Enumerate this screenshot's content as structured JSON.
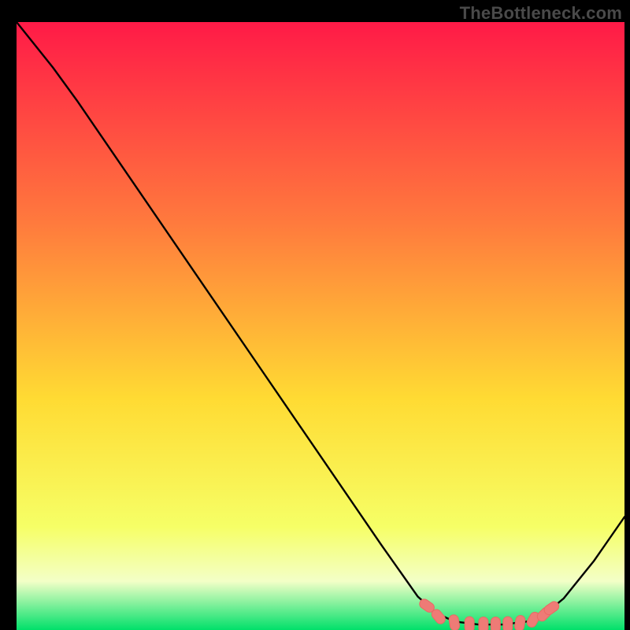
{
  "attribution": "TheBottleneck.com",
  "colors": {
    "gradient_top": "#ff1a47",
    "gradient_mid_upper": "#ff7a3d",
    "gradient_mid": "#ffdb33",
    "gradient_lower": "#f6ff66",
    "gradient_pale": "#f3ffc7",
    "gradient_bottom": "#00e06a",
    "curve": "#000000",
    "marker_fill": "#ee7b76",
    "marker_stroke": "#e86a63"
  },
  "chart_data": {
    "type": "line",
    "title": "",
    "xlabel": "",
    "ylabel": "",
    "xlim": [
      0,
      100
    ],
    "ylim": [
      0,
      100
    ],
    "curve": [
      {
        "x": 0.0,
        "y": 100.0
      },
      {
        "x": 6.0,
        "y": 92.5
      },
      {
        "x": 10.0,
        "y": 87.0
      },
      {
        "x": 20.0,
        "y": 72.4
      },
      {
        "x": 30.0,
        "y": 57.8
      },
      {
        "x": 40.0,
        "y": 43.2
      },
      {
        "x": 50.0,
        "y": 28.6
      },
      {
        "x": 60.0,
        "y": 14.0
      },
      {
        "x": 66.0,
        "y": 5.5
      },
      {
        "x": 69.0,
        "y": 2.8
      },
      {
        "x": 72.0,
        "y": 1.4
      },
      {
        "x": 76.0,
        "y": 0.9
      },
      {
        "x": 80.0,
        "y": 0.9
      },
      {
        "x": 84.0,
        "y": 1.4
      },
      {
        "x": 87.0,
        "y": 2.7
      },
      {
        "x": 90.0,
        "y": 5.2
      },
      {
        "x": 95.0,
        "y": 11.4
      },
      {
        "x": 100.0,
        "y": 18.6
      }
    ],
    "markers": [
      {
        "x": 67.5,
        "y": 4.0,
        "rot": -55
      },
      {
        "x": 69.4,
        "y": 2.2,
        "rot": -40
      },
      {
        "x": 72.0,
        "y": 1.2,
        "rot": -10
      },
      {
        "x": 74.5,
        "y": 0.9,
        "rot": 0
      },
      {
        "x": 76.8,
        "y": 0.85,
        "rot": 0
      },
      {
        "x": 78.8,
        "y": 0.85,
        "rot": 0
      },
      {
        "x": 80.8,
        "y": 0.9,
        "rot": 0
      },
      {
        "x": 82.8,
        "y": 1.1,
        "rot": 10
      },
      {
        "x": 85.0,
        "y": 1.7,
        "rot": 30
      },
      {
        "x": 86.8,
        "y": 2.6,
        "rot": 45
      },
      {
        "x": 88.0,
        "y": 3.6,
        "rot": 55
      }
    ]
  }
}
